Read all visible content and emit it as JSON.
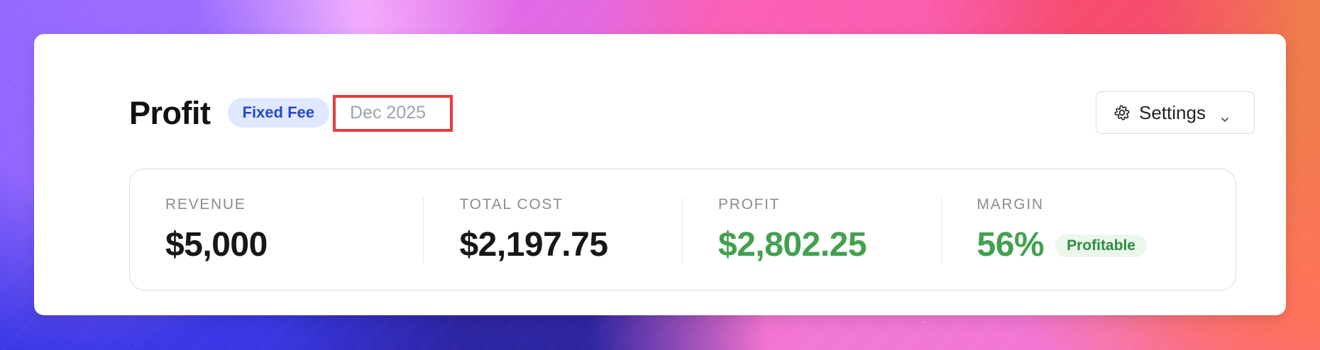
{
  "header": {
    "title": "Profit",
    "type_badge": "Fixed Fee",
    "date_field": {
      "placeholder": "Dec 2025",
      "value": ""
    },
    "settings_label": "Settings",
    "settings_icon": "gear-icon",
    "settings_chevron_icon": "chevron-down-icon"
  },
  "metrics": [
    {
      "label": "REVENUE",
      "value": "$5,000"
    },
    {
      "label": "TOTAL COST",
      "value": "$2,197.75"
    },
    {
      "label": "PROFIT",
      "value": "$2,802.25"
    },
    {
      "label": "MARGIN",
      "value": "56%",
      "badge": "Profitable"
    }
  ],
  "colors": {
    "positive": "#43a04f",
    "badge_blue": "#2448cf",
    "badge_blue_bg": "#dfe8ff",
    "highlight_border": "#ea3b3c",
    "profitable_bg": "#eaf7ea"
  }
}
